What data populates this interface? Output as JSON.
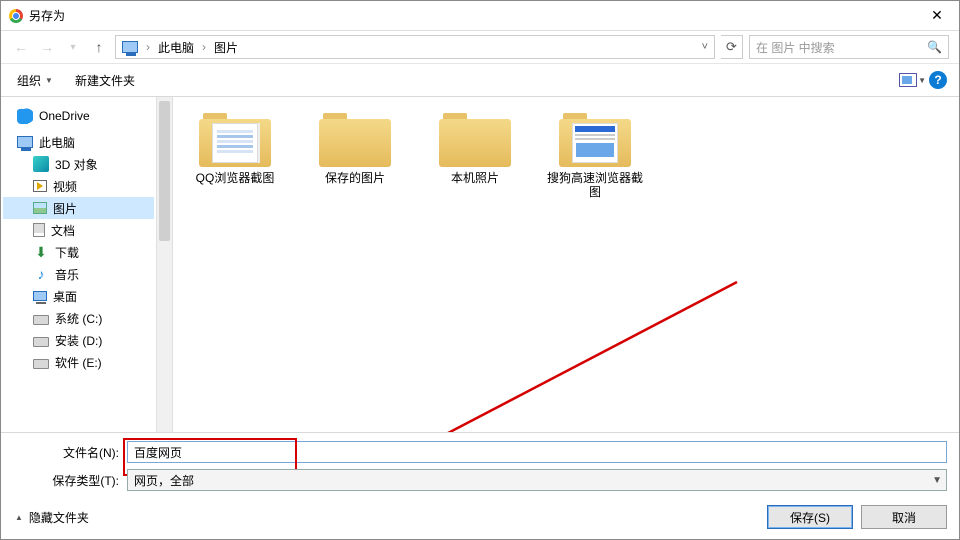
{
  "titlebar": {
    "title": "另存为"
  },
  "navbar": {
    "breadcrumb": {
      "root": "此电脑",
      "folder": "图片"
    },
    "search_placeholder": "在 图片 中搜索"
  },
  "toolbar": {
    "organize": "组织",
    "new_folder": "新建文件夹",
    "help": "?"
  },
  "sidebar": {
    "onedrive": "OneDrive",
    "this_pc": "此电脑",
    "items": [
      {
        "label": "3D 对象"
      },
      {
        "label": "视频"
      },
      {
        "label": "图片"
      },
      {
        "label": "文档"
      },
      {
        "label": "下载"
      },
      {
        "label": "音乐"
      },
      {
        "label": "桌面"
      },
      {
        "label": "系统 (C:)"
      },
      {
        "label": "安装 (D:)"
      },
      {
        "label": "软件 (E:)"
      }
    ]
  },
  "content": {
    "folders": [
      {
        "label": "QQ浏览器截图"
      },
      {
        "label": "保存的图片"
      },
      {
        "label": "本机照片"
      },
      {
        "label": "搜狗高速浏览器截图"
      }
    ]
  },
  "bottom": {
    "filename_label": "文件名(N):",
    "filename_value": "百度网页",
    "filetype_label": "保存类型(T):",
    "filetype_value": "网页，全部",
    "hide_folders": "隐藏文件夹",
    "save": "保存(S)",
    "cancel": "取消"
  }
}
